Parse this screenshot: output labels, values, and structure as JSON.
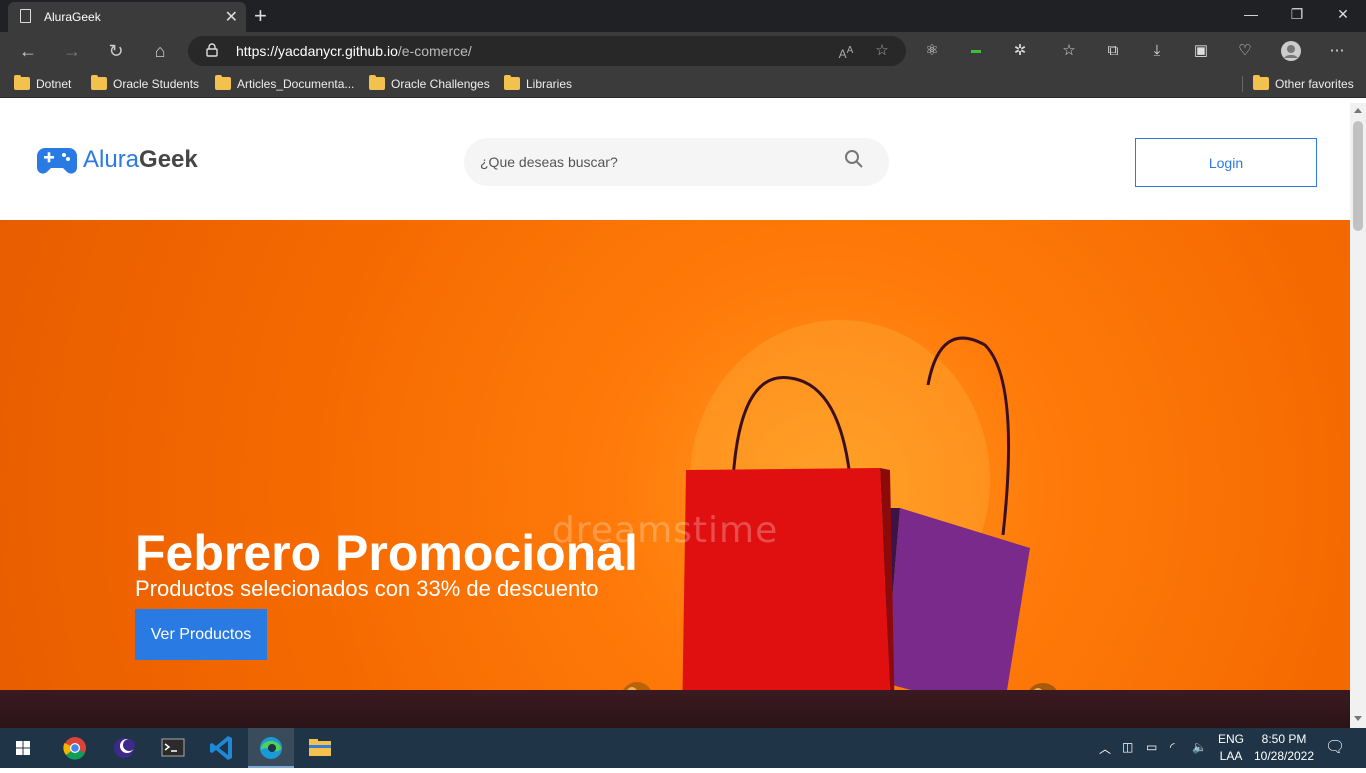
{
  "browser": {
    "tab_title": "AluraGeek",
    "url_host": "https://yacdanycr.github.io",
    "url_path": "/e-comerce/",
    "bookmarks": [
      "Dotnet",
      "Oracle Students",
      "Articles_Documenta...",
      "Oracle Challenges",
      "Libraries"
    ],
    "other_favorites": "Other favorites"
  },
  "header": {
    "logo_main": "Alura",
    "logo_bold": "Geek",
    "search_placeholder": "¿Que deseas buscar?",
    "login_label": "Login"
  },
  "hero": {
    "title": "Febrero Promocional",
    "subtitle": "Productos selecionados con 33% de descuento",
    "button_label": "Ver Productos",
    "watermark": "dreamstime"
  },
  "taskbar": {
    "lang_line1": "ENG",
    "lang_line2": "LAA",
    "time": "8:50 PM",
    "date": "10/28/2022"
  },
  "colors": {
    "brand_blue": "#2a7ae4",
    "hero_orange": "#f56a00"
  }
}
